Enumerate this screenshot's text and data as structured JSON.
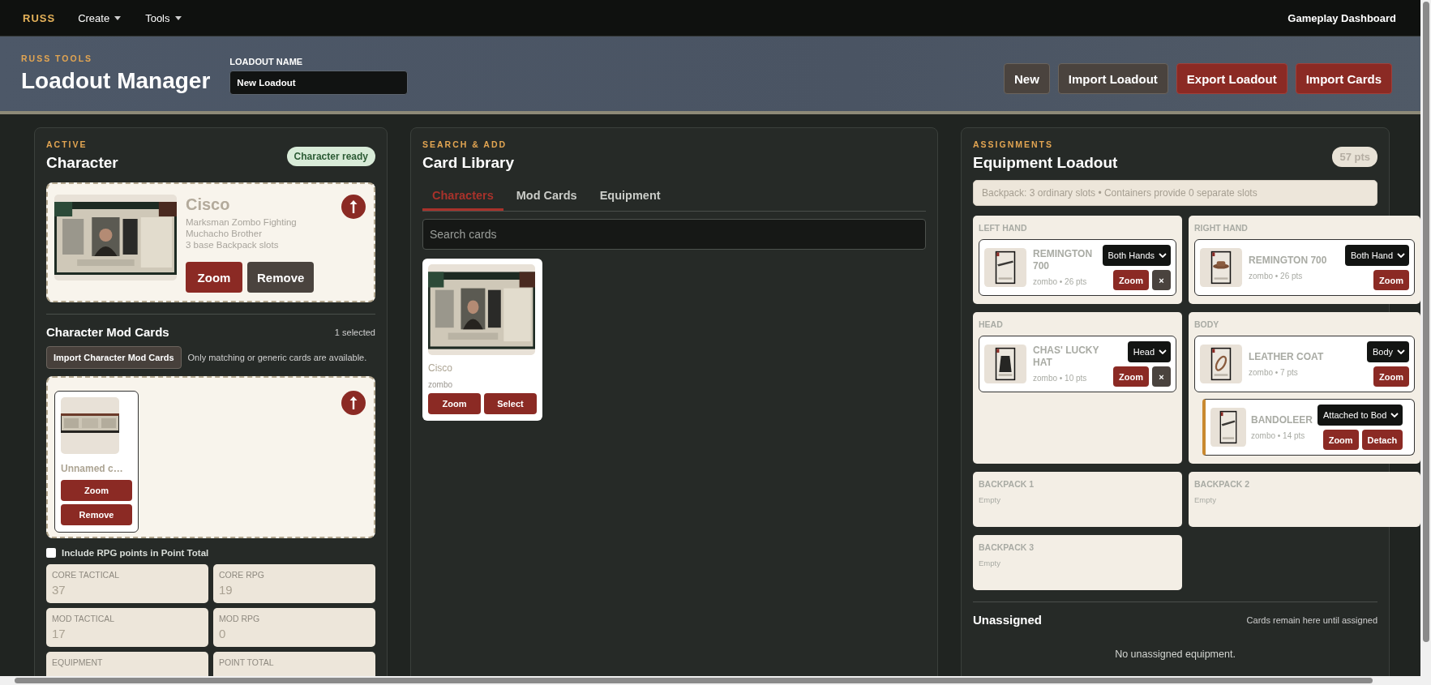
{
  "nav": {
    "brand": "RUSS",
    "menus": [
      {
        "label": "Create"
      },
      {
        "label": "Tools"
      }
    ],
    "right_link": "Gameplay Dashboard"
  },
  "header": {
    "eyebrow": "RUSS TOOLS",
    "title": "Loadout Manager",
    "name_label": "LOADOUT NAME",
    "name_value": "New Loadout",
    "buttons": [
      {
        "label": "New",
        "kind": "dark"
      },
      {
        "label": "Import Loadout",
        "kind": "dark"
      },
      {
        "label": "Export Loadout",
        "kind": "primary"
      },
      {
        "label": "Import Cards",
        "kind": "primary"
      }
    ]
  },
  "character_panel": {
    "eyebrow": "ACTIVE",
    "title": "Character",
    "badge": "Character ready",
    "character": {
      "name": "Cisco",
      "description": "Marksman Zombo Fighting Muchacho Brother",
      "slots": "3 base Backpack slots",
      "buttons": [
        {
          "label": "Zoom",
          "kind": "primary"
        },
        {
          "label": "Remove",
          "kind": "dark"
        }
      ]
    },
    "mods": {
      "title": "Character Mod Cards",
      "count": "1 selected",
      "import_button": "Import Character Mod Cards",
      "note": "Only matching or generic cards are available.",
      "cards": [
        {
          "name": "Unnamed c…",
          "buttons": [
            {
              "label": "Zoom",
              "kind": "primary"
            },
            {
              "label": "Remove",
              "kind": "primary"
            }
          ]
        }
      ]
    },
    "rpg_toggle": {
      "label": "Include RPG points in Point Total",
      "checked": false
    },
    "stats": [
      {
        "label": "CORE TACTICAL",
        "value": "37"
      },
      {
        "label": "CORE RPG",
        "value": "19"
      },
      {
        "label": "MOD TACTICAL",
        "value": "17"
      },
      {
        "label": "MOD RPG",
        "value": "0"
      },
      {
        "label": "EQUIPMENT"
      },
      {
        "label": "POINT TOTAL"
      }
    ]
  },
  "library": {
    "eyebrow": "SEARCH & ADD",
    "title": "Card Library",
    "tabs": [
      {
        "label": "Characters",
        "selected": true
      },
      {
        "label": "Mod Cards",
        "selected": false
      },
      {
        "label": "Equipment",
        "selected": false
      }
    ],
    "search_placeholder": "Search cards",
    "cards": [
      {
        "name": "Cisco",
        "source": "zombo",
        "buttons": [
          {
            "label": "Zoom",
            "kind": "primary"
          },
          {
            "label": "Select",
            "kind": "primary"
          }
        ]
      }
    ]
  },
  "loadout": {
    "eyebrow": "ASSIGNMENTS",
    "title": "Equipment Loadout",
    "points": "57 pts",
    "notice": "Backpack: 3 ordinary slots • Containers provide 0 separate slots",
    "slots": [
      {
        "label": "LEFT HAND",
        "items": [
          {
            "name": "REMINGTON 700",
            "meta": "zombo • 26 pts",
            "placement": "Both Hands",
            "buttons": [
              {
                "label": "Zoom",
                "kind": "primary"
              },
              {
                "label": "×",
                "kind": "dark"
              }
            ]
          }
        ]
      },
      {
        "label": "RIGHT HAND",
        "items": [
          {
            "name": "REMINGTON 700",
            "meta": "zombo • 26 pts",
            "placement": "Both Hand",
            "buttons": [
              {
                "label": "Zoom",
                "kind": "primary"
              }
            ]
          }
        ]
      },
      {
        "label": "HEAD",
        "items": [
          {
            "name": "CHAS' LUCKY HAT",
            "meta": "zombo • 10 pts",
            "placement": "Head",
            "buttons": [
              {
                "label": "Zoom",
                "kind": "primary"
              },
              {
                "label": "×",
                "kind": "dark"
              }
            ]
          }
        ]
      },
      {
        "label": "BODY",
        "items": [
          {
            "name": "LEATHER COAT",
            "meta": "zombo • 7 pts",
            "placement": "Body",
            "buttons": [
              {
                "label": "Zoom",
                "kind": "primary"
              }
            ],
            "attachments": [
              {
                "name": "BANDOLEER",
                "meta": "zombo • 14 pts",
                "placement": "Attached to Bod",
                "buttons": [
                  {
                    "label": "Zoom",
                    "kind": "primary"
                  },
                  {
                    "label": "Detach",
                    "kind": "primary"
                  }
                ]
              }
            ]
          }
        ]
      },
      {
        "label": "BACKPACK 1",
        "empty_text": "Empty"
      },
      {
        "label": "BACKPACK 2",
        "empty_text": "Empty"
      },
      {
        "label": "BACKPACK 3",
        "empty_text": "Empty"
      }
    ],
    "unassigned": {
      "title": "Unassigned",
      "note": "Cards remain here until assigned",
      "empty": "No unassigned equipment."
    }
  }
}
